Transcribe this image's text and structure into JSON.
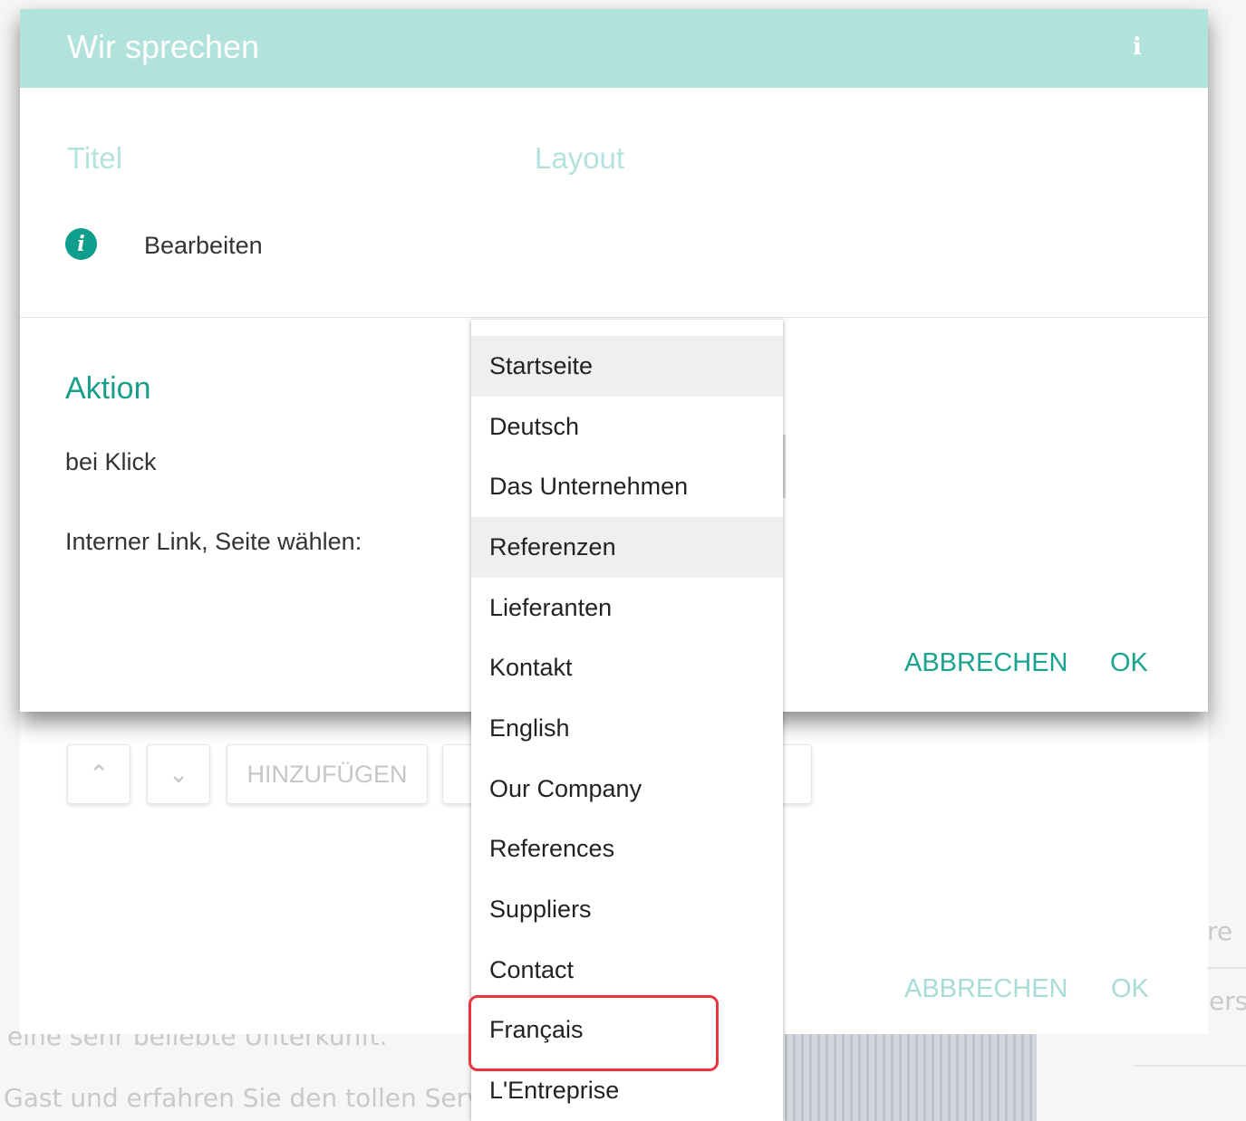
{
  "background": {
    "fragments": [
      "eine sehr beliebte Unterkunft.",
      "Gast und erfahren Sie den tollen Service",
      "re",
      "ers"
    ],
    "toolbar_buttons": [
      "HINZUFÜGEN"
    ],
    "footer_actions": {
      "cancel_label": "ABBRECHEN",
      "ok_label": "OK"
    }
  },
  "dialog": {
    "title": "Wir sprechen",
    "header_icon": "info-icon",
    "tabs": [
      {
        "label": "Titel"
      },
      {
        "label": "Layout"
      }
    ],
    "edit_row": {
      "icon": "info-circle-icon",
      "label": "Bearbeiten"
    },
    "section_heading": "Aktion",
    "on_click_label": "bei Klick",
    "internal_link_label": "Interner Link, Seite wählen:",
    "actions": {
      "cancel_label": "ABBRECHEN",
      "ok_label": "OK"
    }
  },
  "dropdown": {
    "options": [
      {
        "label": "Startseite"
      },
      {
        "label": "Deutsch"
      },
      {
        "label": "Das Unternehmen"
      },
      {
        "label": "Referenzen"
      },
      {
        "label": "Lieferanten"
      },
      {
        "label": "Kontakt"
      },
      {
        "label": "English"
      },
      {
        "label": "Our Company"
      },
      {
        "label": "References"
      },
      {
        "label": "Suppliers"
      },
      {
        "label": "Contact"
      },
      {
        "label": "Français"
      },
      {
        "label": "L'Entreprise"
      }
    ],
    "hovered_option": "Referenzen",
    "annotated_option": "Français"
  },
  "colors": {
    "header_bg": "#b2e2dc",
    "accent": "#1aa38f",
    "tab_text": "#b4e3dd",
    "annotation": "#e8353e"
  }
}
